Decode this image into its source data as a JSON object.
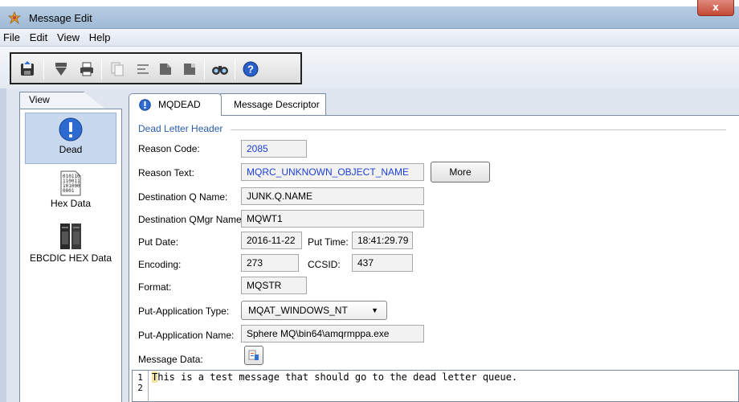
{
  "window": {
    "title": "Message Edit",
    "close_label": "x"
  },
  "menu": [
    "File",
    "Edit",
    "View",
    "Help"
  ],
  "toolbar": {
    "icons": [
      "save-icon",
      "import-icon",
      "print-icon",
      "copy-icon",
      "align-icon",
      "load-icon",
      "export-icon",
      "find-icon",
      "help-icon"
    ]
  },
  "left_panel": {
    "tab_label": "View",
    "items": [
      {
        "label": "Dead",
        "icon": "dead-letter-icon",
        "selected": true
      },
      {
        "label": "Hex Data",
        "icon": "hex-data-icon",
        "selected": false
      },
      {
        "label": "EBCDIC HEX Data",
        "icon": "ebcdic-icon",
        "selected": false
      }
    ]
  },
  "tabs": {
    "active": "MQDEAD",
    "inactive": "Message Descriptor"
  },
  "section_title": "Dead Letter Header",
  "fields": {
    "reason_code_label": "Reason Code:",
    "reason_code": "2085",
    "reason_text_label": "Reason Text:",
    "reason_text": "MQRC_UNKNOWN_OBJECT_NAME",
    "more_button": "More",
    "dest_q_label": "Destination Q Name:",
    "dest_q": "JUNK.Q.NAME",
    "dest_qmgr_label": "Destination QMgr Name:",
    "dest_qmgr": "MQWT1",
    "put_date_label": "Put Date:",
    "put_date": "2016-11-22",
    "put_time_label": "Put Time:",
    "put_time": "18:41:29.79",
    "encoding_label": "Encoding:",
    "encoding": "273",
    "ccsid_label": "CCSID:",
    "ccsid": "437",
    "format_label": "Format:",
    "format": "MQSTR",
    "put_app_type_label": "Put-Application Type:",
    "put_app_type": "MQAT_WINDOWS_NT",
    "put_app_name_label": "Put-Application Name:",
    "put_app_name": "Sphere MQ\\bin64\\amqrmppa.exe",
    "message_data_label": "Message Data:"
  },
  "editor": {
    "line_numbers": [
      "1",
      "2"
    ],
    "first_char": "T",
    "line1_rest": "his is a test message that should go to the dead letter queue."
  },
  "colors": {
    "accent_blue": "#2a5db0",
    "field_value_blue": "#1c3fd8"
  }
}
